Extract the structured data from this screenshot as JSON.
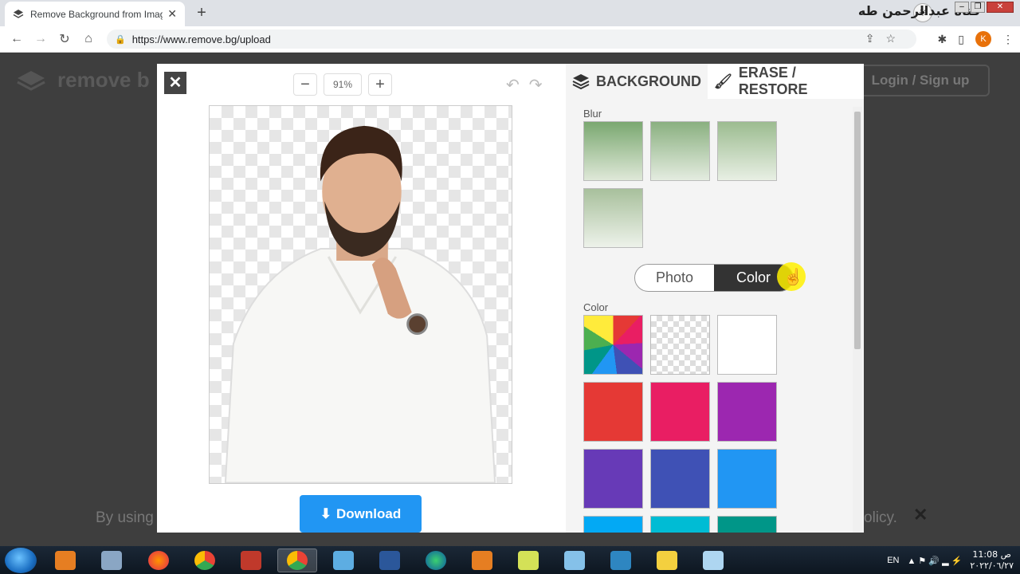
{
  "browser": {
    "tab_title": "Remove Background from Image",
    "url": "https://www.remove.bg/upload",
    "profile_initial": "K",
    "watermark_text": "قناة عبدالرحمن طه"
  },
  "page": {
    "brand": "remove b",
    "login_label": "Login / Sign up",
    "cookie_left": "By using",
    "cookie_right": "olicy."
  },
  "editor": {
    "zoom_value": "91%",
    "download_label": "Download"
  },
  "panel": {
    "tab_background": "BACKGROUND",
    "tab_erase": "ERASE / RESTORE",
    "blur_label": "Blur",
    "toggle_photo": "Photo",
    "toggle_color": "Color",
    "color_label": "Color",
    "swatches": [
      "#e53935",
      "#e91e63",
      "#9c27b0",
      "#673ab7",
      "#3f51b5",
      "#2196f3",
      "#03a9f4",
      "#00bcd4",
      "#009688"
    ]
  },
  "taskbar": {
    "lang": "EN",
    "time": "11:08 ص",
    "date": "٢٠٢٢/٠٦/٢٧"
  }
}
